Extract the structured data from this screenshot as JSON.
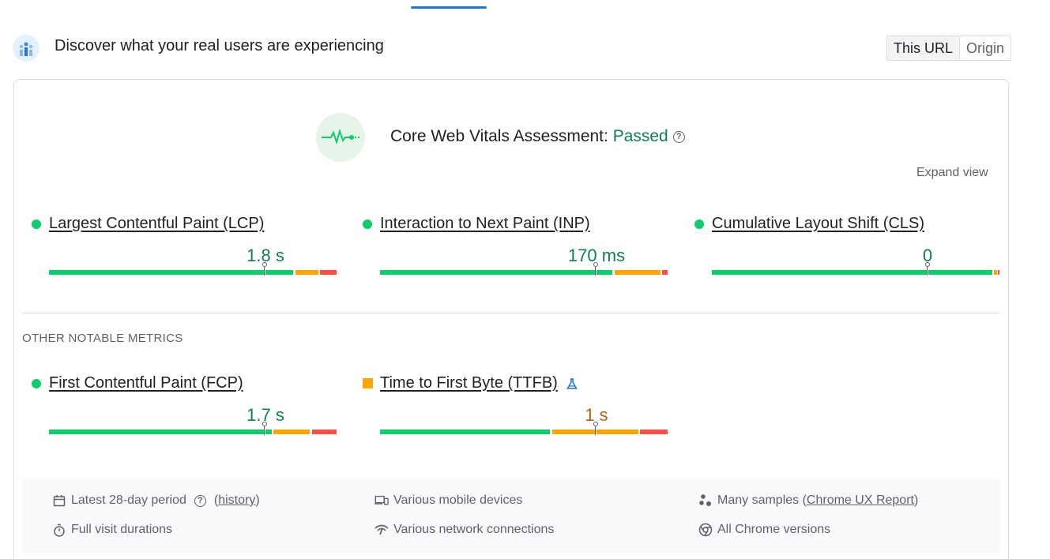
{
  "header": {
    "title": "Discover what your real users are experiencing",
    "toggle": [
      "This URL",
      "Origin"
    ],
    "toggle_active": "This URL"
  },
  "assessment": {
    "label": "Core Web Vitals Assessment: ",
    "status": "Passed",
    "help_glyph": "?",
    "expand_label": "Expand view"
  },
  "core_metrics": [
    {
      "name": "Largest Contentful Paint (LCP)",
      "value": "1.8 s",
      "rating": "good",
      "position": 0.75
    },
    {
      "name": "Interaction to Next Paint (INP)",
      "value": "170 ms",
      "rating": "good",
      "position": 0.75
    },
    {
      "name": "Cumulative Layout Shift (CLS)",
      "value": "0",
      "rating": "good",
      "position": 0.75
    }
  ],
  "other_heading": "OTHER NOTABLE METRICS",
  "other_metrics": [
    {
      "name": "First Contentful Paint (FCP)",
      "value": "1.7 s",
      "rating": "good",
      "position": 0.75
    },
    {
      "name": "Time to First Byte (TTFB)",
      "value": "1 s",
      "rating": "needs-improvement",
      "position": 0.75
    }
  ],
  "info": {
    "period": "Latest 28-day period",
    "history_link": "history",
    "devices": "Various mobile devices",
    "samples_prefix": "Many samples (",
    "samples_link": "Chrome UX Report",
    "samples_suffix": ")",
    "durations": "Full visit durations",
    "network": "Various network connections",
    "chrome": "All Chrome versions"
  },
  "colors": {
    "good": "#0cce6b",
    "needs_improvement": "#ffa400",
    "poor": "#ff4e42",
    "passed_text": "#0d8050",
    "accent": "#1a73e8"
  }
}
